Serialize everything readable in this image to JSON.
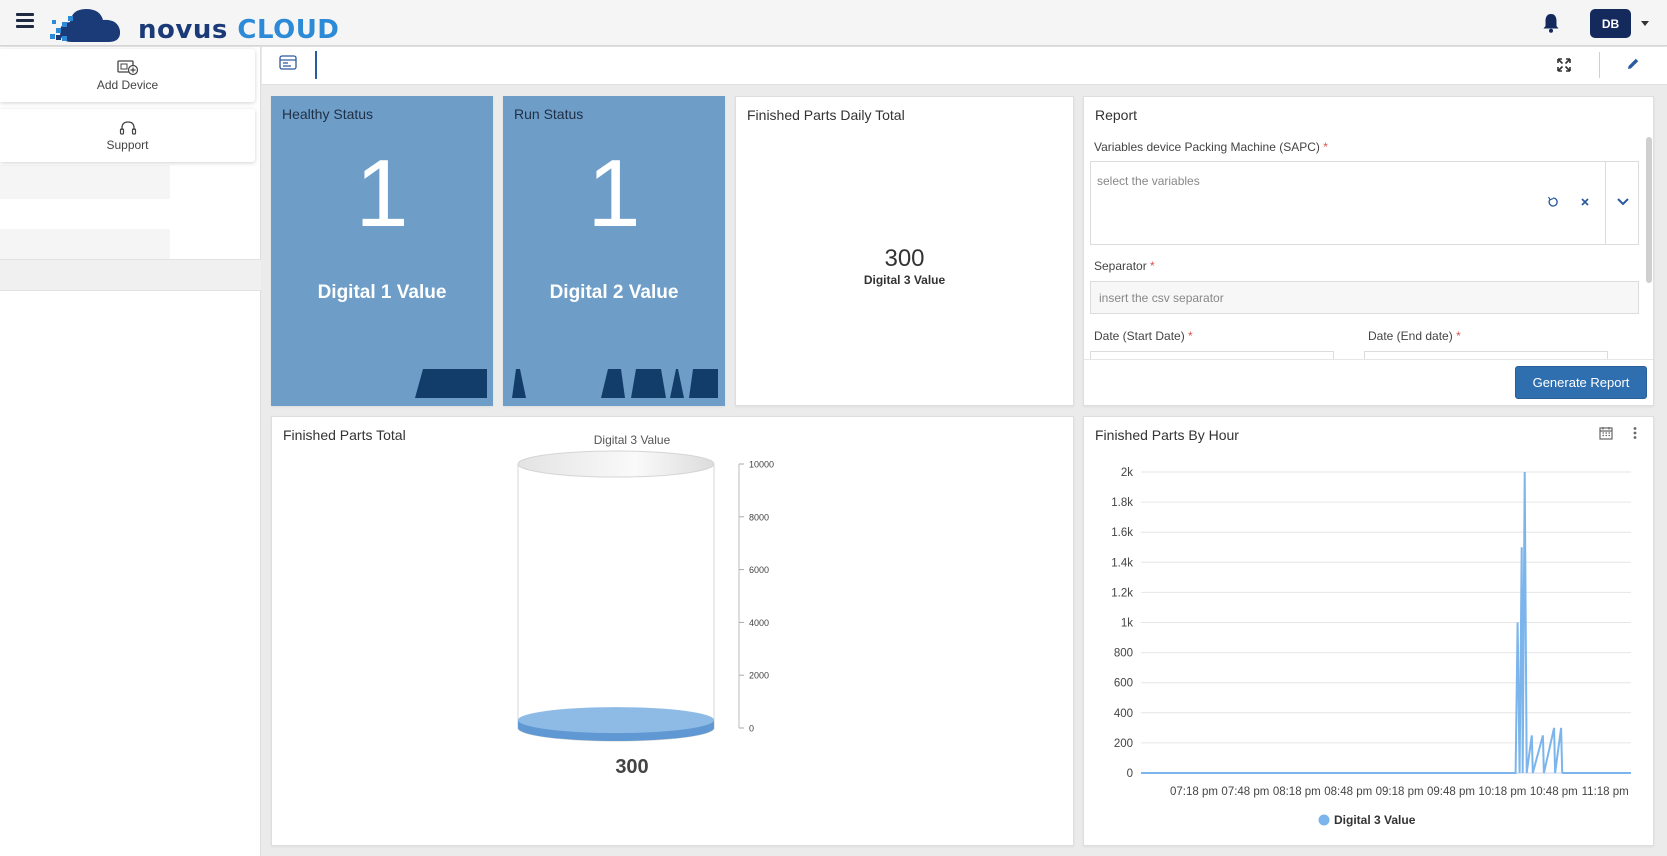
{
  "brand": {
    "word1": "novus",
    "word2": "CLOUD"
  },
  "header": {
    "user_initials": "DB"
  },
  "sidebar": {
    "items": [
      {
        "label": "Add Device",
        "icon": "add-device-icon"
      },
      {
        "label": "Support",
        "icon": "headset-icon"
      }
    ]
  },
  "widgets": {
    "healthy": {
      "title": "Healthy Status",
      "value": "1",
      "label": "Digital 1 Value"
    },
    "run": {
      "title": "Run Status",
      "value": "1",
      "label": "Digital 2 Value"
    },
    "daily": {
      "title": "Finished Parts Daily Total",
      "value": "300",
      "label": "Digital 3 Value"
    },
    "report": {
      "title": "Report",
      "variables_label": "Variables device Packing Machine (SAPC)",
      "variables_placeholder": "select the variables",
      "separator_label": "Separator",
      "separator_placeholder": "insert the csv separator",
      "start_label": "Date (Start Date)",
      "end_label": "Date (End date)",
      "required_mark": "*",
      "generate_label": "Generate Report"
    },
    "total": {
      "title": "Finished Parts Total"
    },
    "byhour": {
      "title": "Finished Parts By Hour"
    }
  },
  "chart_data": [
    {
      "type": "bar",
      "subtype": "cylinder-gauge",
      "title": "Digital 3 Value",
      "value": 300,
      "value_label": "300",
      "ylim": [
        0,
        10000
      ],
      "yticks": [
        0,
        2000,
        4000,
        6000,
        8000,
        10000
      ],
      "ytick_labels": [
        "0",
        "2000",
        "4000",
        "6000",
        "8000",
        "10000"
      ],
      "color": "#8ebbe6"
    },
    {
      "type": "line",
      "title": "",
      "x": [
        "07:18 pm",
        "07:48 pm",
        "08:18 pm",
        "08:48 pm",
        "09:18 pm",
        "09:48 pm",
        "10:18 pm",
        "10:48 pm",
        "11:18 pm"
      ],
      "xtick_labels": [
        "07:18 pm",
        "07:48 pm",
        "08:18 pm",
        "08:48 pm",
        "09:18 pm",
        "09:48 pm",
        "10:18 pm",
        "10:48 pm",
        "11:18 pm"
      ],
      "ytick_labels": [
        "0",
        "200",
        "400",
        "600",
        "800",
        "1k",
        "1.2k",
        "1.4k",
        "1.6k",
        "1.8k",
        "2k"
      ],
      "ylim": [
        0,
        2000
      ],
      "series": [
        {
          "name": "Digital 3 Value",
          "color": "#7cb5ec",
          "points": [
            {
              "t": 0,
              "v": 0
            },
            {
              "t": 370,
              "v": 0
            },
            {
              "t": 372,
              "v": 1000
            },
            {
              "t": 374,
              "v": 0
            },
            {
              "t": 376,
              "v": 1500
            },
            {
              "t": 377,
              "v": 0
            },
            {
              "t": 379,
              "v": 2000
            },
            {
              "t": 381,
              "v": 0
            },
            {
              "t": 386,
              "v": 250
            },
            {
              "t": 387,
              "v": 0
            },
            {
              "t": 397,
              "v": 250
            },
            {
              "t": 398,
              "v": 0
            },
            {
              "t": 408,
              "v": 300
            },
            {
              "t": 409,
              "v": 0
            },
            {
              "t": 415,
              "v": 300
            },
            {
              "t": 416,
              "v": 0
            }
          ]
        }
      ],
      "legend": "bottom-center",
      "grid": true
    }
  ]
}
